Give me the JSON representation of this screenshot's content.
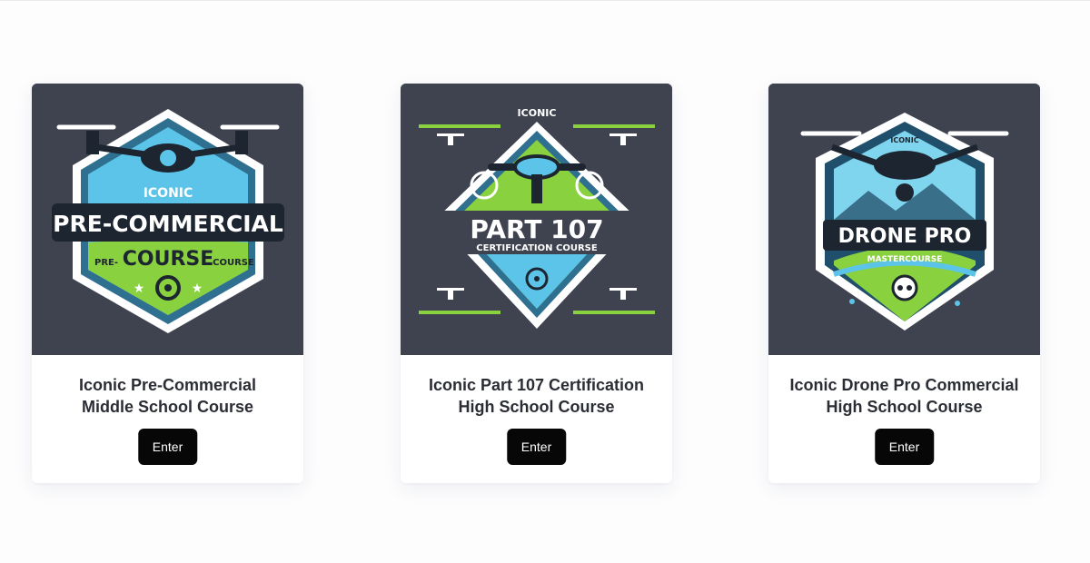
{
  "courses": [
    {
      "title_line1": "Iconic Pre-Commercial",
      "title_line2": "Middle School Course",
      "button_label": "Enter",
      "badge": {
        "line_top": "ICONIC",
        "line_main": "PRE-COMMERCIAL",
        "line_bottom": "COURSE",
        "ribbon_left": "PRE-",
        "ribbon_right": "COURSE",
        "icon": "drone-icon",
        "colors": {
          "background": "#3f4350",
          "accent": "#5bc4e8",
          "secondary": "#8ad13f"
        }
      }
    },
    {
      "title_line1": "Iconic Part 107 Certification",
      "title_line2": "High School Course",
      "button_label": "Enter",
      "badge": {
        "line_top": "ICONIC",
        "line_main": "PART 107",
        "line_bottom": "CERTIFICATION COURSE",
        "icon": "drone-icon",
        "colors": {
          "background": "#3f4350",
          "accent": "#5bc4e8",
          "secondary": "#8ad13f"
        }
      }
    },
    {
      "title_line1": "Iconic Drone Pro Commercial",
      "title_line2": "High School Course",
      "button_label": "Enter",
      "badge": {
        "line_top": "ICONIC",
        "line_main": "DRONE PRO",
        "line_bottom": "MASTERCOURSE",
        "icon": "drone-icon",
        "colors": {
          "background": "#3f4350",
          "accent": "#5bc4e8",
          "secondary": "#8ad13f"
        }
      }
    }
  ]
}
